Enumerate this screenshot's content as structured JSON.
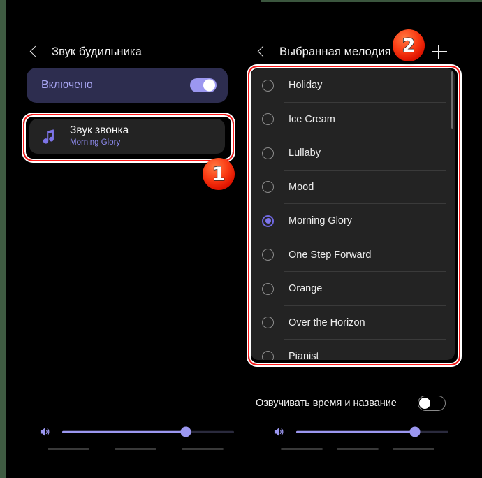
{
  "left_panel": {
    "header": {
      "back_icon": "back-chevron-icon",
      "title": "Звук будильника"
    },
    "enabled_card": {
      "label": "Включено",
      "toggle_state": "on",
      "bg_color": "#2d2d4f",
      "label_color": "#a9a6f4"
    },
    "ringtone_row": {
      "icon": "music-note-icon",
      "title": "Звук звонка",
      "subtitle": "Morning Glory",
      "subtitle_color": "#8e8bf0"
    },
    "volume": {
      "icon": "speaker-volume-icon",
      "value_percent": 62
    },
    "nav_pills": 3
  },
  "right_panel": {
    "header": {
      "back_icon": "back-chevron-icon",
      "title": "Выбранная мелодия",
      "add_icon": "plus-icon"
    },
    "melodies": [
      {
        "label": "Holiday",
        "selected": false
      },
      {
        "label": "Ice Cream",
        "selected": false
      },
      {
        "label": "Lullaby",
        "selected": false
      },
      {
        "label": "Mood",
        "selected": false
      },
      {
        "label": "Morning Glory",
        "selected": true
      },
      {
        "label": "One Step Forward",
        "selected": false
      },
      {
        "label": "Orange",
        "selected": false
      },
      {
        "label": "Over the Horizon",
        "selected": false
      },
      {
        "label": "Pianist",
        "selected": false
      }
    ],
    "speak_row": {
      "label": "Озвучивать время и название",
      "toggle_state": "off"
    },
    "volume": {
      "icon": "speaker-volume-icon",
      "value_percent": 70
    },
    "nav_pills": 3
  },
  "annotations": {
    "badges": [
      {
        "number": "1"
      },
      {
        "number": "2"
      }
    ],
    "highlight_color": "#ff1717",
    "badge_color": "#fa3c14"
  }
}
